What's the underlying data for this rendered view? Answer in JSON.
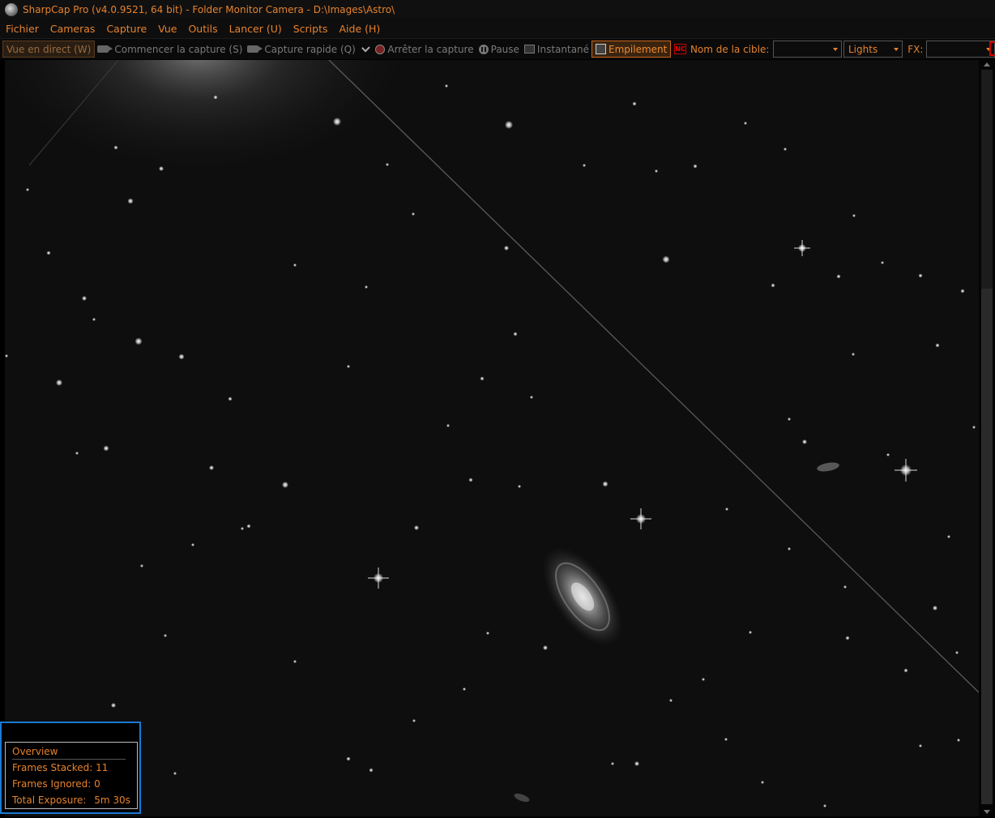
{
  "window": {
    "title": "SharpCap Pro (v4.0.9521, 64 bit) - Folder Monitor Camera - D:\\Images\\Astro\\"
  },
  "menu": [
    "Fichier",
    "Cameras",
    "Capture",
    "Vue",
    "Outils",
    "Lancer (U)",
    "Scripts",
    "Aide (H)"
  ],
  "toolbar": {
    "live_view": "Vue en direct (W)",
    "start_capture": "Commencer la capture (S)",
    "quick_capture": "Capture rapide (Q)",
    "stop_capture": "Arrêter la capture",
    "pause": "Pause",
    "snapshot": "Instantané",
    "stacking": "Empilement",
    "nc_icon_text": "NC",
    "target_label": "Nom de la cible:",
    "target_value": "",
    "frame_type": "Lights",
    "fx_label": "FX:",
    "fx_value": ""
  },
  "overview": {
    "title": "Overview",
    "frames_stacked_label": "Frames Stacked:",
    "frames_stacked_value": "11",
    "frames_ignored_label": "Frames Ignored:",
    "frames_ignored_value": "0",
    "total_exposure_label": "Total Exposure:",
    "total_exposure_value": "5m 30s"
  },
  "colors": {
    "accent": "#e6822d",
    "highlight_border": "#1a7ad4"
  }
}
